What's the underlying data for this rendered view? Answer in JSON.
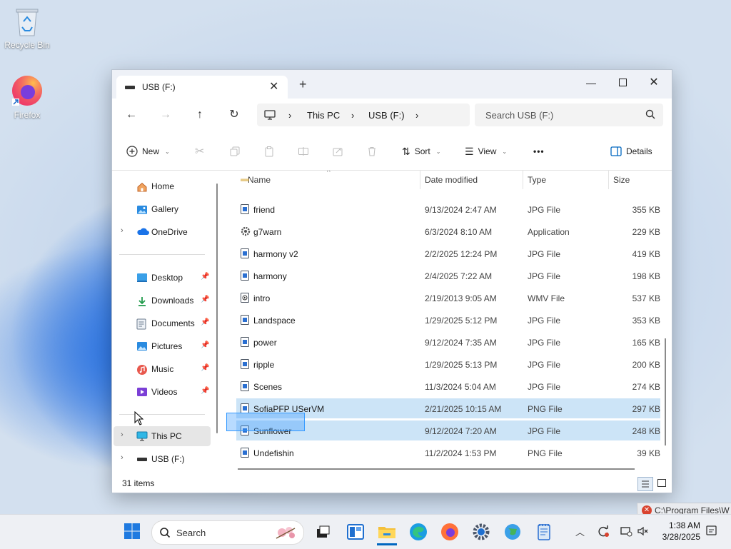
{
  "desktop": {
    "icons": [
      {
        "label": "Recycle Bin",
        "icon": "recycle-bin-icon"
      },
      {
        "label": "Firefox",
        "icon": "firefox-icon"
      }
    ]
  },
  "window": {
    "tab_title": "USB (F:)",
    "breadcrumb": [
      "This PC",
      "USB (F:)"
    ],
    "search_placeholder": "Search USB (F:)",
    "toolbar": {
      "new_label": "New",
      "sort_label": "Sort",
      "view_label": "View",
      "more_label": "•••",
      "details_label": "Details"
    },
    "sidebar": {
      "home": "Home",
      "gallery": "Gallery",
      "onedrive": "OneDrive",
      "desktop": "Desktop",
      "downloads": "Downloads",
      "documents": "Documents",
      "pictures": "Pictures",
      "music": "Music",
      "videos": "Videos",
      "thispc": "This PC",
      "usb": "USB (F:)"
    },
    "columns": {
      "name": "Name",
      "date": "Date modified",
      "type": "Type",
      "size": "Size"
    },
    "files": [
      {
        "name": "friend",
        "date": "9/13/2024 2:47 AM",
        "type": "JPG File",
        "size": "355 KB"
      },
      {
        "name": "g7warn",
        "date": "6/3/2024 8:10 AM",
        "type": "Application",
        "size": "229 KB"
      },
      {
        "name": "harmony v2",
        "date": "2/2/2025 12:24 PM",
        "type": "JPG File",
        "size": "419 KB"
      },
      {
        "name": "harmony",
        "date": "2/4/2025 7:22 AM",
        "type": "JPG File",
        "size": "198 KB"
      },
      {
        "name": "intro",
        "date": "2/19/2013 9:05 AM",
        "type": "WMV File",
        "size": "537 KB"
      },
      {
        "name": "Landspace",
        "date": "1/29/2025 5:12 PM",
        "type": "JPG File",
        "size": "353 KB"
      },
      {
        "name": "power",
        "date": "9/12/2024 7:35 AM",
        "type": "JPG File",
        "size": "165 KB"
      },
      {
        "name": "ripple",
        "date": "1/29/2025 5:13 PM",
        "type": "JPG File",
        "size": "200 KB"
      },
      {
        "name": "Scenes",
        "date": "11/3/2024 5:04 AM",
        "type": "JPG File",
        "size": "274 KB"
      },
      {
        "name": "SofiaPFP USerVM",
        "date": "2/21/2025 10:15 AM",
        "type": "PNG File",
        "size": "297 KB"
      },
      {
        "name": "Sunflower",
        "date": "9/12/2024 7:20 AM",
        "type": "JPG File",
        "size": "248 KB"
      },
      {
        "name": "Undefishin",
        "date": "11/2/2024 1:53 PM",
        "type": "PNG File",
        "size": "39 KB"
      }
    ],
    "status": "31 items"
  },
  "taskbar": {
    "search_placeholder": "Search",
    "time": "1:38 AM",
    "date": "3/28/2025"
  },
  "notification": {
    "text": "C:\\Program Files\\W"
  },
  "colors": {
    "selection": "#cce4f7",
    "accent": "#0067c0"
  }
}
